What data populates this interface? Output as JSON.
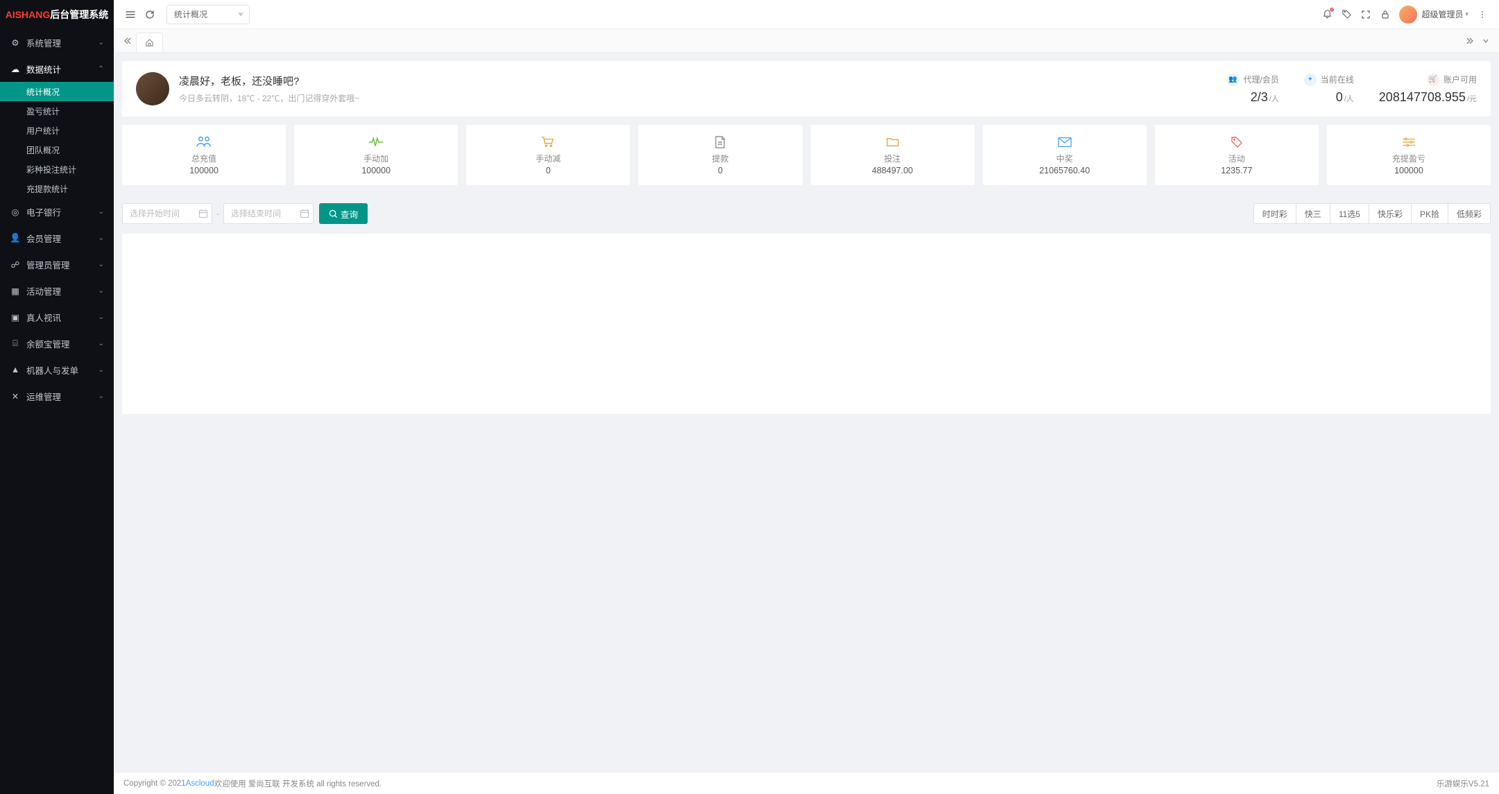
{
  "app": {
    "logo_red": "AISHANG",
    "logo_white": "后台管理系统"
  },
  "sidebar": {
    "items": [
      {
        "icon": "gear",
        "label": "系统管理",
        "expanded": false
      },
      {
        "icon": "chart",
        "label": "数据统计",
        "expanded": true,
        "children": [
          {
            "label": "统计概况",
            "active": true
          },
          {
            "label": "盈亏统计"
          },
          {
            "label": "用户统计"
          },
          {
            "label": "团队概况"
          },
          {
            "label": "彩种投注统计"
          },
          {
            "label": "充提款统计"
          }
        ]
      },
      {
        "icon": "coin",
        "label": "电子银行",
        "expanded": false
      },
      {
        "icon": "user",
        "label": "会员管理",
        "expanded": false
      },
      {
        "icon": "admin",
        "label": "管理员管理",
        "expanded": false
      },
      {
        "icon": "calendar",
        "label": "活动管理",
        "expanded": false
      },
      {
        "icon": "video",
        "label": "真人视讯",
        "expanded": false
      },
      {
        "icon": "wallet",
        "label": "余额宝管理",
        "expanded": false
      },
      {
        "icon": "robot",
        "label": "机器人与发单",
        "expanded": false
      },
      {
        "icon": "ops",
        "label": "运维管理",
        "expanded": false
      }
    ]
  },
  "topbar": {
    "select_value": "统计概况",
    "user_name": "超级管理员"
  },
  "tabs": {
    "home_icon": "home"
  },
  "greet": {
    "title": "凌晨好，老板，还没睡吧?",
    "sub": "今日多云转阴，18℃ - 22℃，出门记得穿外套哦~"
  },
  "headstats": [
    {
      "icon": "green",
      "label": "代理/会员",
      "value": "2/3",
      "unit": "/人"
    },
    {
      "icon": "blue",
      "label": "当前在线",
      "value": "0",
      "unit": "/人"
    },
    {
      "icon": "red",
      "label": "账户可用",
      "value": "208147708.955",
      "unit": "/元"
    }
  ],
  "statcards": [
    {
      "color": "#409eff",
      "name": "总充值",
      "value": "100000"
    },
    {
      "color": "#67c23a",
      "name": "手动加",
      "value": "100000"
    },
    {
      "color": "#e6a23c",
      "name": "手动减",
      "value": "0"
    },
    {
      "color": "#909399",
      "name": "提款",
      "value": "0"
    },
    {
      "color": "#e6a23c",
      "name": "投注",
      "value": "488497.00"
    },
    {
      "color": "#409eff",
      "name": "中奖",
      "value": "21065760.40"
    },
    {
      "color": "#f56c6c",
      "name": "活动",
      "value": "1235.77"
    },
    {
      "color": "#e6a23c",
      "name": "充提盈亏",
      "value": "100000"
    }
  ],
  "filter": {
    "start_placeholder": "选择开始时间",
    "end_placeholder": "选择结束时间",
    "query_label": "查询",
    "tabs": [
      "时时彩",
      "快三",
      "11选5",
      "快乐彩",
      "PK拾",
      "低频彩"
    ]
  },
  "footer": {
    "left_prefix": "Copyright © 2021 ",
    "left_link": "Ascloud",
    "left_suffix": " 欢迎使用 爱尚互联 开发系统 all rights reserved.",
    "right": "乐游娱乐V5.21"
  }
}
